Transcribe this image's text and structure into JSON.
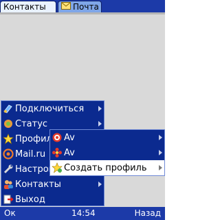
{
  "tabs": [
    {
      "label": "Контакты",
      "active": true
    },
    {
      "label": "Почта",
      "active": false
    }
  ],
  "main_menu": [
    {
      "label": "Подключиться",
      "icon": "connect-icon",
      "submenu": true
    },
    {
      "label": "Статус",
      "icon": "status-icon",
      "submenu": true
    },
    {
      "label": "Профил",
      "icon": "profile-star-icon",
      "submenu": true
    },
    {
      "label": "Mail.ru",
      "icon": "mailru-icon",
      "submenu": true
    },
    {
      "label": "Настрой",
      "icon": "wrench-icon",
      "submenu": true
    },
    {
      "label": "Контакты",
      "icon": "contacts-icon",
      "submenu": true
    },
    {
      "label": "Выход",
      "icon": "exit-icon",
      "submenu": false
    }
  ],
  "profile_submenu": [
    {
      "label": "Av",
      "icon": "av-target-icon",
      "submenu": true
    },
    {
      "label": "Av",
      "icon": "av-flower-icon",
      "submenu": true
    },
    {
      "label": "Создать профиль",
      "icon": "create-star-icon",
      "submenu": true,
      "selected": true
    }
  ],
  "softkeys": {
    "left": "Ок",
    "time": "14:54",
    "right": "Назад"
  },
  "colors": {
    "bar": "#1c3aa8",
    "menu": "#0b2a8f",
    "background": "#d9d9d9"
  }
}
